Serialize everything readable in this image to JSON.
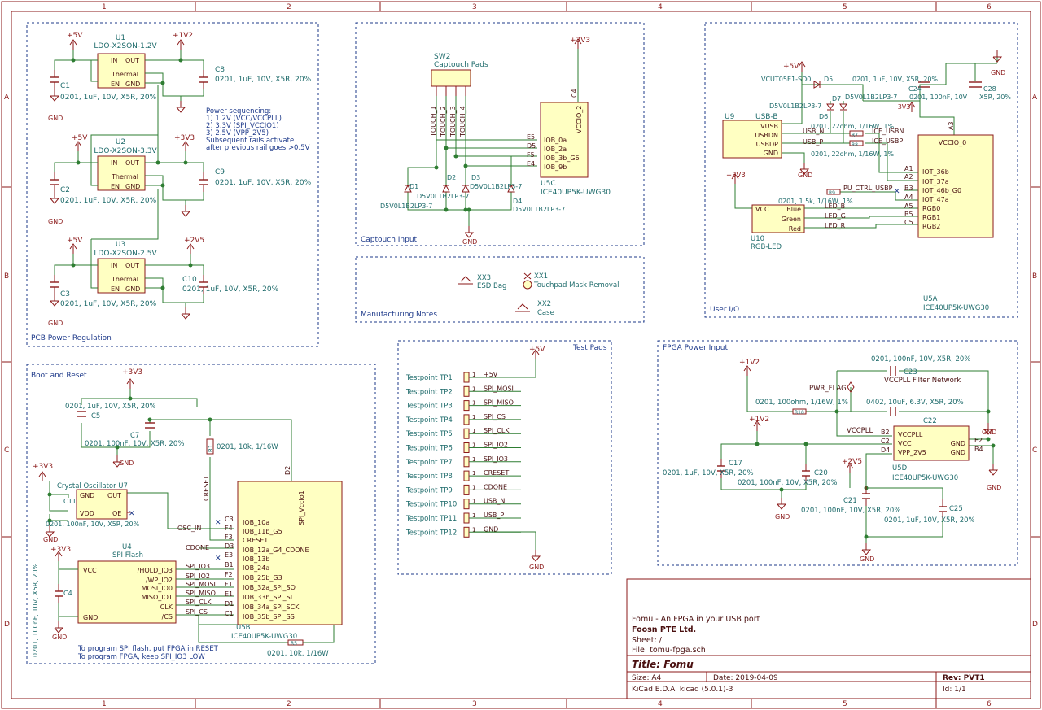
{
  "frame": {
    "col_labels": [
      "1",
      "2",
      "3",
      "4",
      "5",
      "6"
    ],
    "row_labels": [
      "A",
      "B",
      "C",
      "D"
    ]
  },
  "blocks": {
    "pcb_power": "PCB Power Regulation",
    "captouch": "Captouch Input",
    "manufacturing": "Manufacturing Notes",
    "user_io": "User I/O",
    "boot_reset": "Boot and Reset",
    "test_pads": "Test Pads",
    "fpga_power": "FPGA Power Input"
  },
  "power_reg": {
    "rails": [
      {
        "vin": "+5V",
        "ref": "U1",
        "part": "LDO-X2SON-1.2V",
        "vout": "+1V2",
        "cin": "C1",
        "cout": "C8"
      },
      {
        "vin": "+5V",
        "ref": "U2",
        "part": "LDO-X2SON-3.3V",
        "vout": "+3V3",
        "cin": "C2",
        "cout": "C9"
      },
      {
        "vin": "+5V",
        "ref": "U3",
        "part": "LDO-X2SON-2.5V",
        "vout": "+2V5",
        "cin": "C3",
        "cout": "C10"
      }
    ],
    "pin_in": "IN",
    "pin_out": "OUT",
    "pin_thermal": "Thermal",
    "pin_en": "EN",
    "pin_gnd": "GND",
    "cap_value": "0201, 1uF, 10V, X5R, 20%",
    "gnd": "GND",
    "notes": [
      "Power sequencing:",
      "1) 1.2V (VCC/VCCPLL)",
      "2) 3.3V (SPI_VCCIO1)",
      "3) 2.5V (VPP_2V5)",
      "Subsequent rails activate",
      "after previous rail goes >0.5V"
    ]
  },
  "captouch": {
    "sw_ref": "SW2",
    "sw_name": "Captouch Pads",
    "touch": [
      "TOUCH_1",
      "TOUCH_2",
      "TOUCH_3",
      "TOUCH_4"
    ],
    "vdd": "+3V3",
    "fpga_title": "VCCIO_2",
    "fpga_pin_c4": "C4",
    "fpga_pins": [
      {
        "num": "E5",
        "name": "IOB_0a"
      },
      {
        "num": "D5",
        "name": "IOB_2a"
      },
      {
        "num": "F5",
        "name": "IOB_3b_G6"
      },
      {
        "num": "E4",
        "name": "IOB_9b"
      }
    ],
    "fpga_ref": "U5C",
    "fpga_part": "ICE40UP5K-UWG30",
    "diodes": [
      "D1",
      "D2",
      "D3",
      "D4"
    ],
    "diode_part": "D5V0L1B2LP3-7",
    "gnd": "GND"
  },
  "manufacturing": {
    "items": [
      {
        "ref": "XX3",
        "name": "ESD Bag"
      },
      {
        "ref": "XX1",
        "name": "Touchpad Mask Removal"
      },
      {
        "ref": "XX2",
        "name": "Case"
      }
    ]
  },
  "user_io": {
    "vcc5": "+5V",
    "vcc33": "+3V3",
    "d5_part": "VCUT05E1-SD0",
    "d5_ref": "D5",
    "d6_ref": "D6",
    "d7_ref": "D7",
    "d_part": "D5V0L1B2LP3-7",
    "c24": "C24",
    "c28": "C28",
    "c24_val": "0201, 100nF, 10V",
    "c28_val": "0201, 1uF, 10V, X5R, 20%",
    "c28_short": "X5R, 20%",
    "u9_ref": "U9",
    "u9_part": "USB-B",
    "u9_pins": [
      "VUSB",
      "USBDN",
      "USBDP",
      "GND"
    ],
    "usb_n": "USB_N",
    "usb_p": "USB_P",
    "r_usb_val": "0201, 22ohm, 1/16W, 1%",
    "r_usb_refs": [
      "R7",
      "R8"
    ],
    "ice_usbn": "ICE_USBN",
    "ice_usbp": "ICE_USBP",
    "pu_label": "PU_CTRL_USBP",
    "r9": "R9",
    "r_led_val": "0201, 1.5k, 1/16W, 1%",
    "u10_ref": "U10",
    "u10_part": "RGB-LED",
    "u10_pins": [
      "VCC",
      "Blue",
      "Green",
      "Red"
    ],
    "led_nets": [
      "LED_B",
      "LED_G",
      "LED_R"
    ],
    "fpga_title": "VCCIO_0",
    "fpga_vcc_pin": "A3",
    "fpga_pins": [
      {
        "num": "A1",
        "name": "IOT_36b"
      },
      {
        "num": "A2",
        "name": "IOT_37a"
      },
      {
        "num": "B3",
        "name": "IOT_46b_G0"
      },
      {
        "num": "A4",
        "name": "IOT_47a"
      },
      {
        "num": "A5",
        "name": "RGB0"
      },
      {
        "num": "B5",
        "name": "RGB1"
      },
      {
        "num": "C5",
        "name": "RGB2"
      }
    ],
    "fpga_ref": "U5A",
    "fpga_part": "ICE40UP5K-UWG30",
    "gnd": "GND"
  },
  "boot": {
    "vdd": "+3V3",
    "c5": "C5",
    "c5_val": "0201, 1uF, 10V, X5R, 20%",
    "c7": "C7",
    "c7_val": "0201, 100nF, 10V, X5R, 20%",
    "r1": "R1",
    "r1_val": "0201, 10k, 1/16W",
    "creset": "CRESET",
    "osc_ref": "Crystal Oscillator U7",
    "osc_pins": [
      "GND",
      "OUT",
      "VDD",
      "OE"
    ],
    "c11": "C11",
    "c11_val": "0201, 100nF, 10V, X5R, 20%",
    "osc_in": "OSC_IN",
    "cdone": "CDONE",
    "flash_ref": "U4",
    "flash_name": "SPI Flash",
    "flash_left": [
      "VCC",
      "GND"
    ],
    "flash_right": [
      "/HOLD_IO3",
      "/WP_IO2",
      "MOSI_IO0",
      "MISO_IO1",
      "CLK",
      "/CS"
    ],
    "c4": "C4",
    "c4_val": "0201, 100nF, 10V, X5R, 20%",
    "spi_nets": [
      "SPI_IO3",
      "SPI_IO2",
      "SPI_MOSI",
      "SPI_MISO",
      "SPI_CLK",
      "SPI_CS"
    ],
    "fpga_title": "SPI_Vccio1",
    "fpga_vcc_pin": "D2",
    "fpga_pins": [
      {
        "num": "C3",
        "name": "IOB_10a"
      },
      {
        "num": "F4",
        "name": "IOB_11b_G5"
      },
      {
        "num": "F3",
        "name": "CRESET"
      },
      {
        "num": "D3",
        "name": "IOB_12a_G4_CDONE"
      },
      {
        "num": "E3",
        "name": "IOB_13b"
      },
      {
        "num": "B1",
        "name": "IOB_24a"
      },
      {
        "num": "F2",
        "name": "IOB_25b_G3"
      },
      {
        "num": "F1",
        "name": "IOB_32a_SPI_SO"
      },
      {
        "num": "E1",
        "name": "IOB_33b_SPI_SI"
      },
      {
        "num": "D1",
        "name": "IOB_34a_SPI_SCK"
      },
      {
        "num": "C1",
        "name": "IOB_35b_SPI_SS"
      }
    ],
    "fpga_ref": "U5B",
    "fpga_part": "ICE40UP5K-UWG30",
    "r5": "R5",
    "r5_val": "0201, 10k, 1/16W",
    "note1": "To program SPI flash, put FPGA in RESET",
    "note2": "To program FPGA, keep SPI_IO3 LOW",
    "gnd": "GND"
  },
  "test_pads": {
    "vdd": "+5V",
    "pads": [
      {
        "name": "Testpoint TP1",
        "net": "+5V"
      },
      {
        "name": "Testpoint TP2",
        "net": "SPI_MOSI"
      },
      {
        "name": "Testpoint TP3",
        "net": "SPI_MISO"
      },
      {
        "name": "Testpoint TP4",
        "net": "SPI_CS"
      },
      {
        "name": "Testpoint TP5",
        "net": "SPI_CLK"
      },
      {
        "name": "Testpoint TP6",
        "net": "SPI_IO2"
      },
      {
        "name": "Testpoint TP7",
        "net": "SPI_IO3"
      },
      {
        "name": "Testpoint TP8",
        "net": "CRESET"
      },
      {
        "name": "Testpoint TP9",
        "net": "CDONE"
      },
      {
        "name": "Testpoint TP10",
        "net": "USB_N"
      },
      {
        "name": "Testpoint TP11",
        "net": "USB_P"
      },
      {
        "name": "Testpoint TP12",
        "net": "GND"
      }
    ],
    "pin": "1",
    "gnd": "GND"
  },
  "fpga_power": {
    "v12": "+1V2",
    "c23_val": "0201, 100nF, 10V, X5R, 20%",
    "c23": "C23",
    "filter": "VCCPLL Filter Network",
    "pwr_flag": "PWR_FLAG",
    "r10_val": "0201, 100ohm, 1/16W, 1%",
    "r10": "R10",
    "c22_val": "0402, 10uF, 6.3V, X5R, 20%",
    "c22": "C22",
    "vccpll": "VCCPLL",
    "v12b": "+1V2",
    "c17": "C17",
    "c17_val": "0201, 1uF, 10V, X5R, 20%",
    "c20": "C20",
    "c20_val": "0201, 100nF, 10V, X5R, 20%",
    "v25": "+2V5",
    "c21": "C21",
    "c21_val": "0201, 100nF, 10V, X5R, 20%",
    "c25": "C25",
    "c25_val": "0201, 1uF, 10V, X5R, 20%",
    "u5_pins_left": [
      {
        "num": "B2",
        "name": "VCCPLL"
      },
      {
        "num": "C2",
        "name": "VCC"
      },
      {
        "num": "D4",
        "name": "VPP_2V5"
      }
    ],
    "u5_pins_right": [
      {
        "num": "E2",
        "name": "GND"
      },
      {
        "num": "B4",
        "name": "GND"
      }
    ],
    "fpga_ref": "U5D",
    "fpga_part": "ICE40UP5K-UWG30",
    "gnd": "GND"
  },
  "title_block": {
    "project": "Fomu - An FPGA in your USB port",
    "company": "Foosn PTE Ltd.",
    "sheet": "Sheet: /",
    "file": "File: tomu-fpga.sch",
    "title": "Title: Fomu",
    "size": "Size: A4",
    "date": "Date: 2019-04-09",
    "rev": "Rev: PVT1",
    "tool": "KiCad E.D.A.  kicad (5.0.1)-3",
    "id": "Id: 1/1"
  }
}
